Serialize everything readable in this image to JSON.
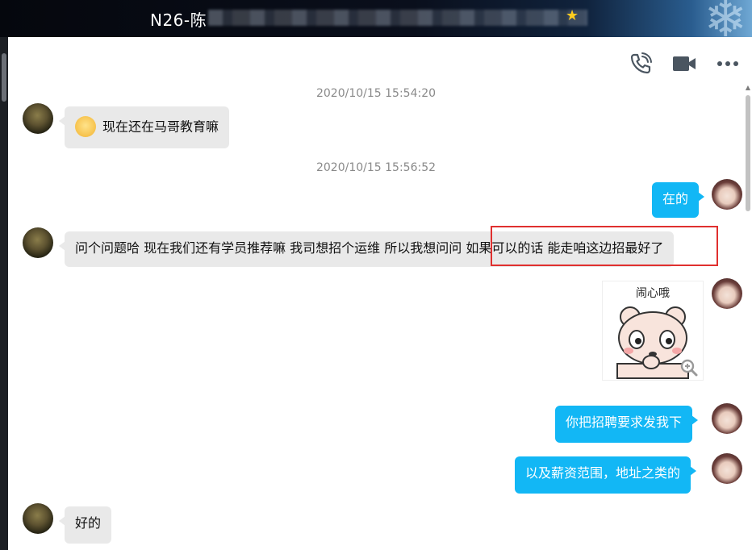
{
  "window": {
    "title": "N26-陈",
    "badge": "star-badge-icon"
  },
  "toolbar": {
    "call_icon": "phone-call-icon",
    "video_icon": "video-call-icon",
    "more_icon": "more-icon"
  },
  "messages": [
    {
      "type": "timestamp",
      "text": "2020/10/15 15:54:20"
    },
    {
      "type": "incoming",
      "emoji": "smile-emoji-icon",
      "text": "现在还在马哥教育嘛"
    },
    {
      "type": "timestamp",
      "text": "2020/10/15 15:56:52"
    },
    {
      "type": "outgoing",
      "text": "在的"
    },
    {
      "type": "incoming",
      "text": "问个问题哈 现在我们还有学员推荐嘛  我司想招个运维 所以我想问问  如果可以的话 能走咱这边招最好了"
    },
    {
      "type": "outgoing-sticker",
      "text": "闹心哦"
    },
    {
      "type": "outgoing",
      "text": "你把招聘要求发我下"
    },
    {
      "type": "outgoing",
      "text": "以及薪资范围，地址之类的"
    },
    {
      "type": "incoming",
      "text": "好的"
    }
  ],
  "colors": {
    "outgoing_bubble": "#12b7f5",
    "incoming_bubble": "#e9e9e9",
    "highlight": "#e0302f"
  }
}
